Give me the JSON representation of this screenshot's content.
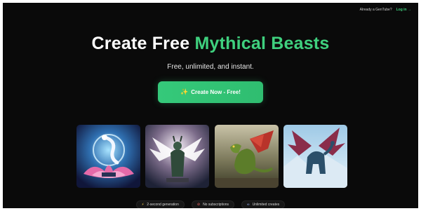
{
  "header": {
    "already_text": "Already a GenTube?",
    "login_label": "Log in →"
  },
  "hero": {
    "title_prefix": "Create Free ",
    "title_accent": "Mythical Beasts",
    "subtitle": "Free, unlimited, and instant.",
    "cta_icon": "sparkles-icon",
    "cta_label": "Create Now - Free!"
  },
  "gallery": [
    {
      "name": "blue-dragon-lotus-image"
    },
    {
      "name": "white-winged-beast-image"
    },
    {
      "name": "green-dragon-image"
    },
    {
      "name": "blue-winged-dragon-snow-image"
    }
  ],
  "features": [
    {
      "icon": "lightning-icon",
      "label": "2-second generation"
    },
    {
      "icon": "no-subscription-icon",
      "label": "No subscriptions"
    },
    {
      "icon": "infinity-icon",
      "label": "Unlimited creates"
    }
  ],
  "colors": {
    "accent": "#3fd07e",
    "background": "#0a0a0a"
  }
}
